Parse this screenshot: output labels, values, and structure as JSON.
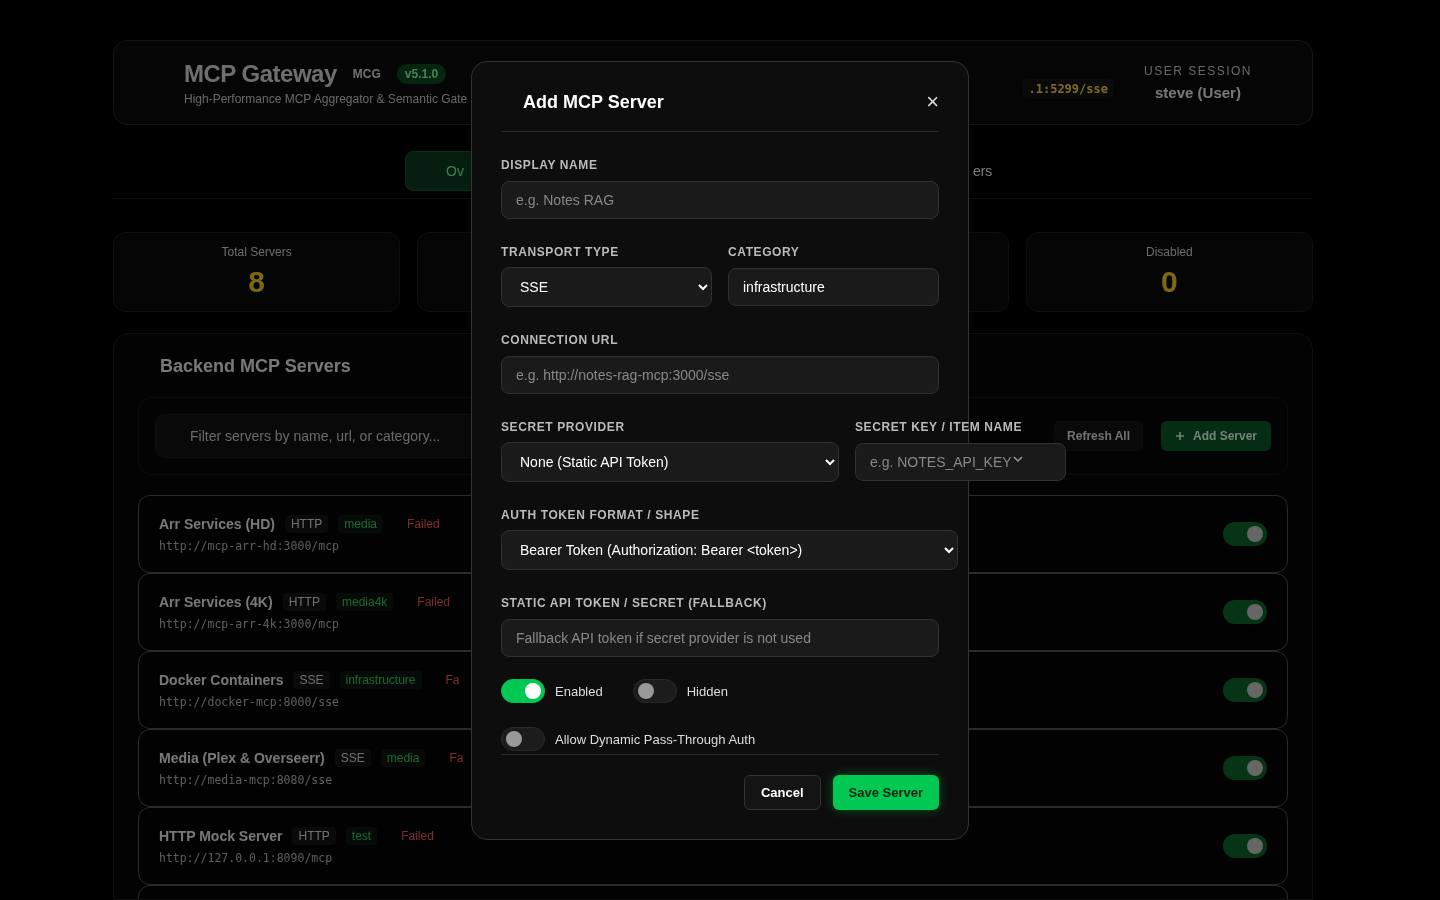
{
  "header": {
    "title": "MCP Gateway",
    "abbr": "MCG",
    "version": "v5.1.0",
    "subtitle": "High-Performance MCP Aggregator & Semantic Gate",
    "endpoint": ".1:5299/sse",
    "session_label": "USER SESSION",
    "session_user": "steve (User)"
  },
  "tabs": [
    {
      "label": "Ov",
      "selected": true
    },
    {
      "label": "ers",
      "selected": false
    }
  ],
  "stats": [
    {
      "kind": "stat",
      "label": "Total Servers",
      "value": "8"
    },
    {
      "kind": "covered"
    },
    {
      "kind": "covered"
    },
    {
      "kind": "stat",
      "label": "Disabled",
      "value": "0"
    }
  ],
  "servers": {
    "title": "Backend MCP Servers",
    "filter_placeholder": "Filter servers by name, url, or category...",
    "refresh_button": "Refresh All",
    "add_button": "Add Server",
    "rows": [
      {
        "name": "Arr Services (HD)",
        "transport": "HTTP",
        "category": "media",
        "status": "Failed",
        "url": "http://mcp-arr-hd:3000/mcp",
        "enabled": true
      },
      {
        "name": "Arr Services (4K)",
        "transport": "HTTP",
        "category": "media4k",
        "status": "Failed",
        "url": "http://mcp-arr-4k:3000/mcp",
        "enabled": true
      },
      {
        "name": "Docker Containers",
        "transport": "SSE",
        "category": "infrastructure",
        "status": "Fa",
        "url": "http://docker-mcp:8000/sse",
        "enabled": true
      },
      {
        "name": "Media (Plex & Overseerr)",
        "transport": "SSE",
        "category": "media",
        "status": "Fa",
        "url": "http://media-mcp:8080/sse",
        "enabled": true
      },
      {
        "name": "HTTP Mock Server",
        "transport": "HTTP",
        "category": "test",
        "status": "Failed",
        "url": "http://127.0.0.1:8090/mcp",
        "enabled": true
      }
    ]
  },
  "modal": {
    "title": "Add MCP Server",
    "close": "×",
    "display_name": {
      "label": "DISPLAY NAME",
      "placeholder": "e.g. Notes RAG"
    },
    "transport": {
      "label": "TRANSPORT TYPE",
      "value": "SSE"
    },
    "category": {
      "label": "CATEGORY",
      "value": "infrastructure"
    },
    "url": {
      "label": "CONNECTION URL",
      "placeholder": "e.g. http://notes-rag-mcp:3000/sse"
    },
    "secret_provider": {
      "label": "SECRET PROVIDER",
      "value": "None (Static API Token)"
    },
    "secret_key": {
      "label": "SECRET KEY / ITEM NAME",
      "placeholder": "e.g. NOTES_API_KEY"
    },
    "auth_format": {
      "label": "AUTH TOKEN FORMAT / SHAPE",
      "value": "Bearer Token (Authorization: Bearer <token>)"
    },
    "static_token": {
      "label": "STATIC API TOKEN / SECRET (FALLBACK)",
      "placeholder": "Fallback API token if secret provider is not used"
    },
    "toggles": [
      {
        "label": "Enabled",
        "on": true
      },
      {
        "label": "Hidden",
        "on": false
      }
    ],
    "pass_through": {
      "label": "Allow Dynamic Pass-Through Auth",
      "on": false
    },
    "cancel": "Cancel",
    "save": "Save Server"
  }
}
